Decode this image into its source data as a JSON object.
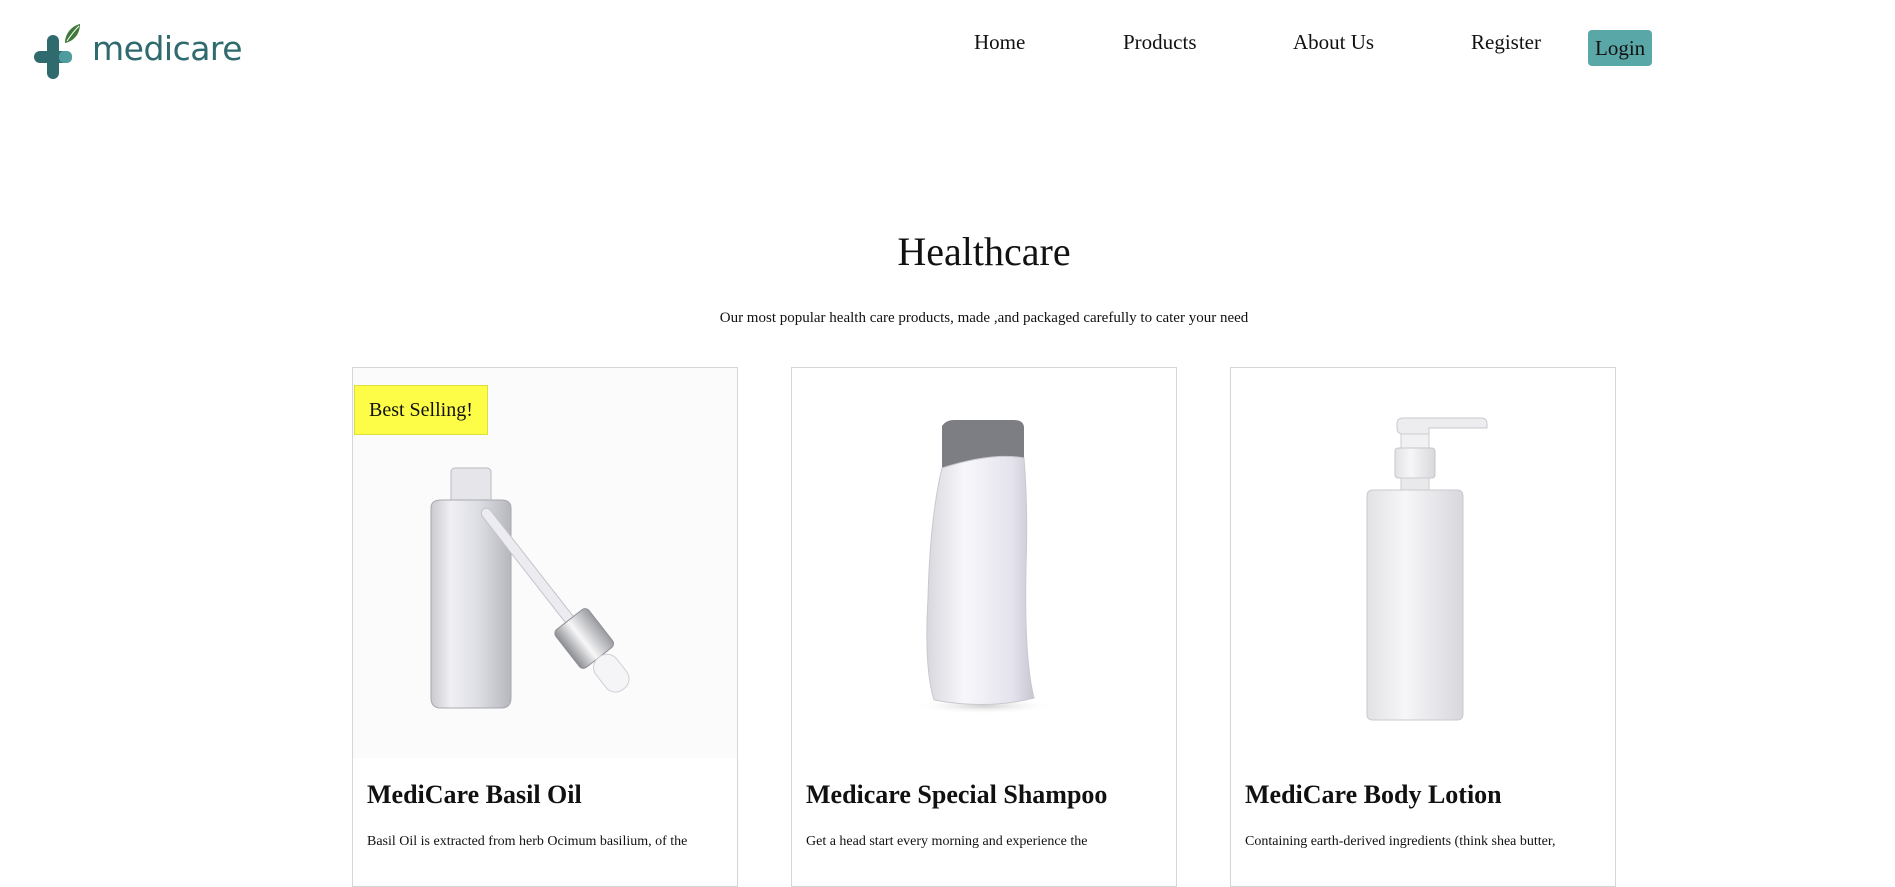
{
  "header": {
    "logo_text": "medicare",
    "nav": {
      "home": "Home",
      "products": "Products",
      "about": "About Us",
      "register": "Register"
    },
    "login_label": "Login"
  },
  "section": {
    "title": "Healthcare",
    "subtitle": "Our most popular health care products, made ,and packaged carefully to cater your need"
  },
  "products": [
    {
      "badge": "Best Selling!",
      "name": "MediCare Basil Oil",
      "description": "Basil Oil is extracted from herb Ocimum basilium, of the"
    },
    {
      "name": "Medicare Special Shampoo",
      "description": "Get a head start every morning and experience the"
    },
    {
      "name": "MediCare Body Lotion",
      "description": "Containing earth-derived ingredients (think shea butter,"
    }
  ],
  "colors": {
    "brand": "#2f6a6e",
    "login_button": "#5aa7a8",
    "badge": "#fdfd48"
  }
}
